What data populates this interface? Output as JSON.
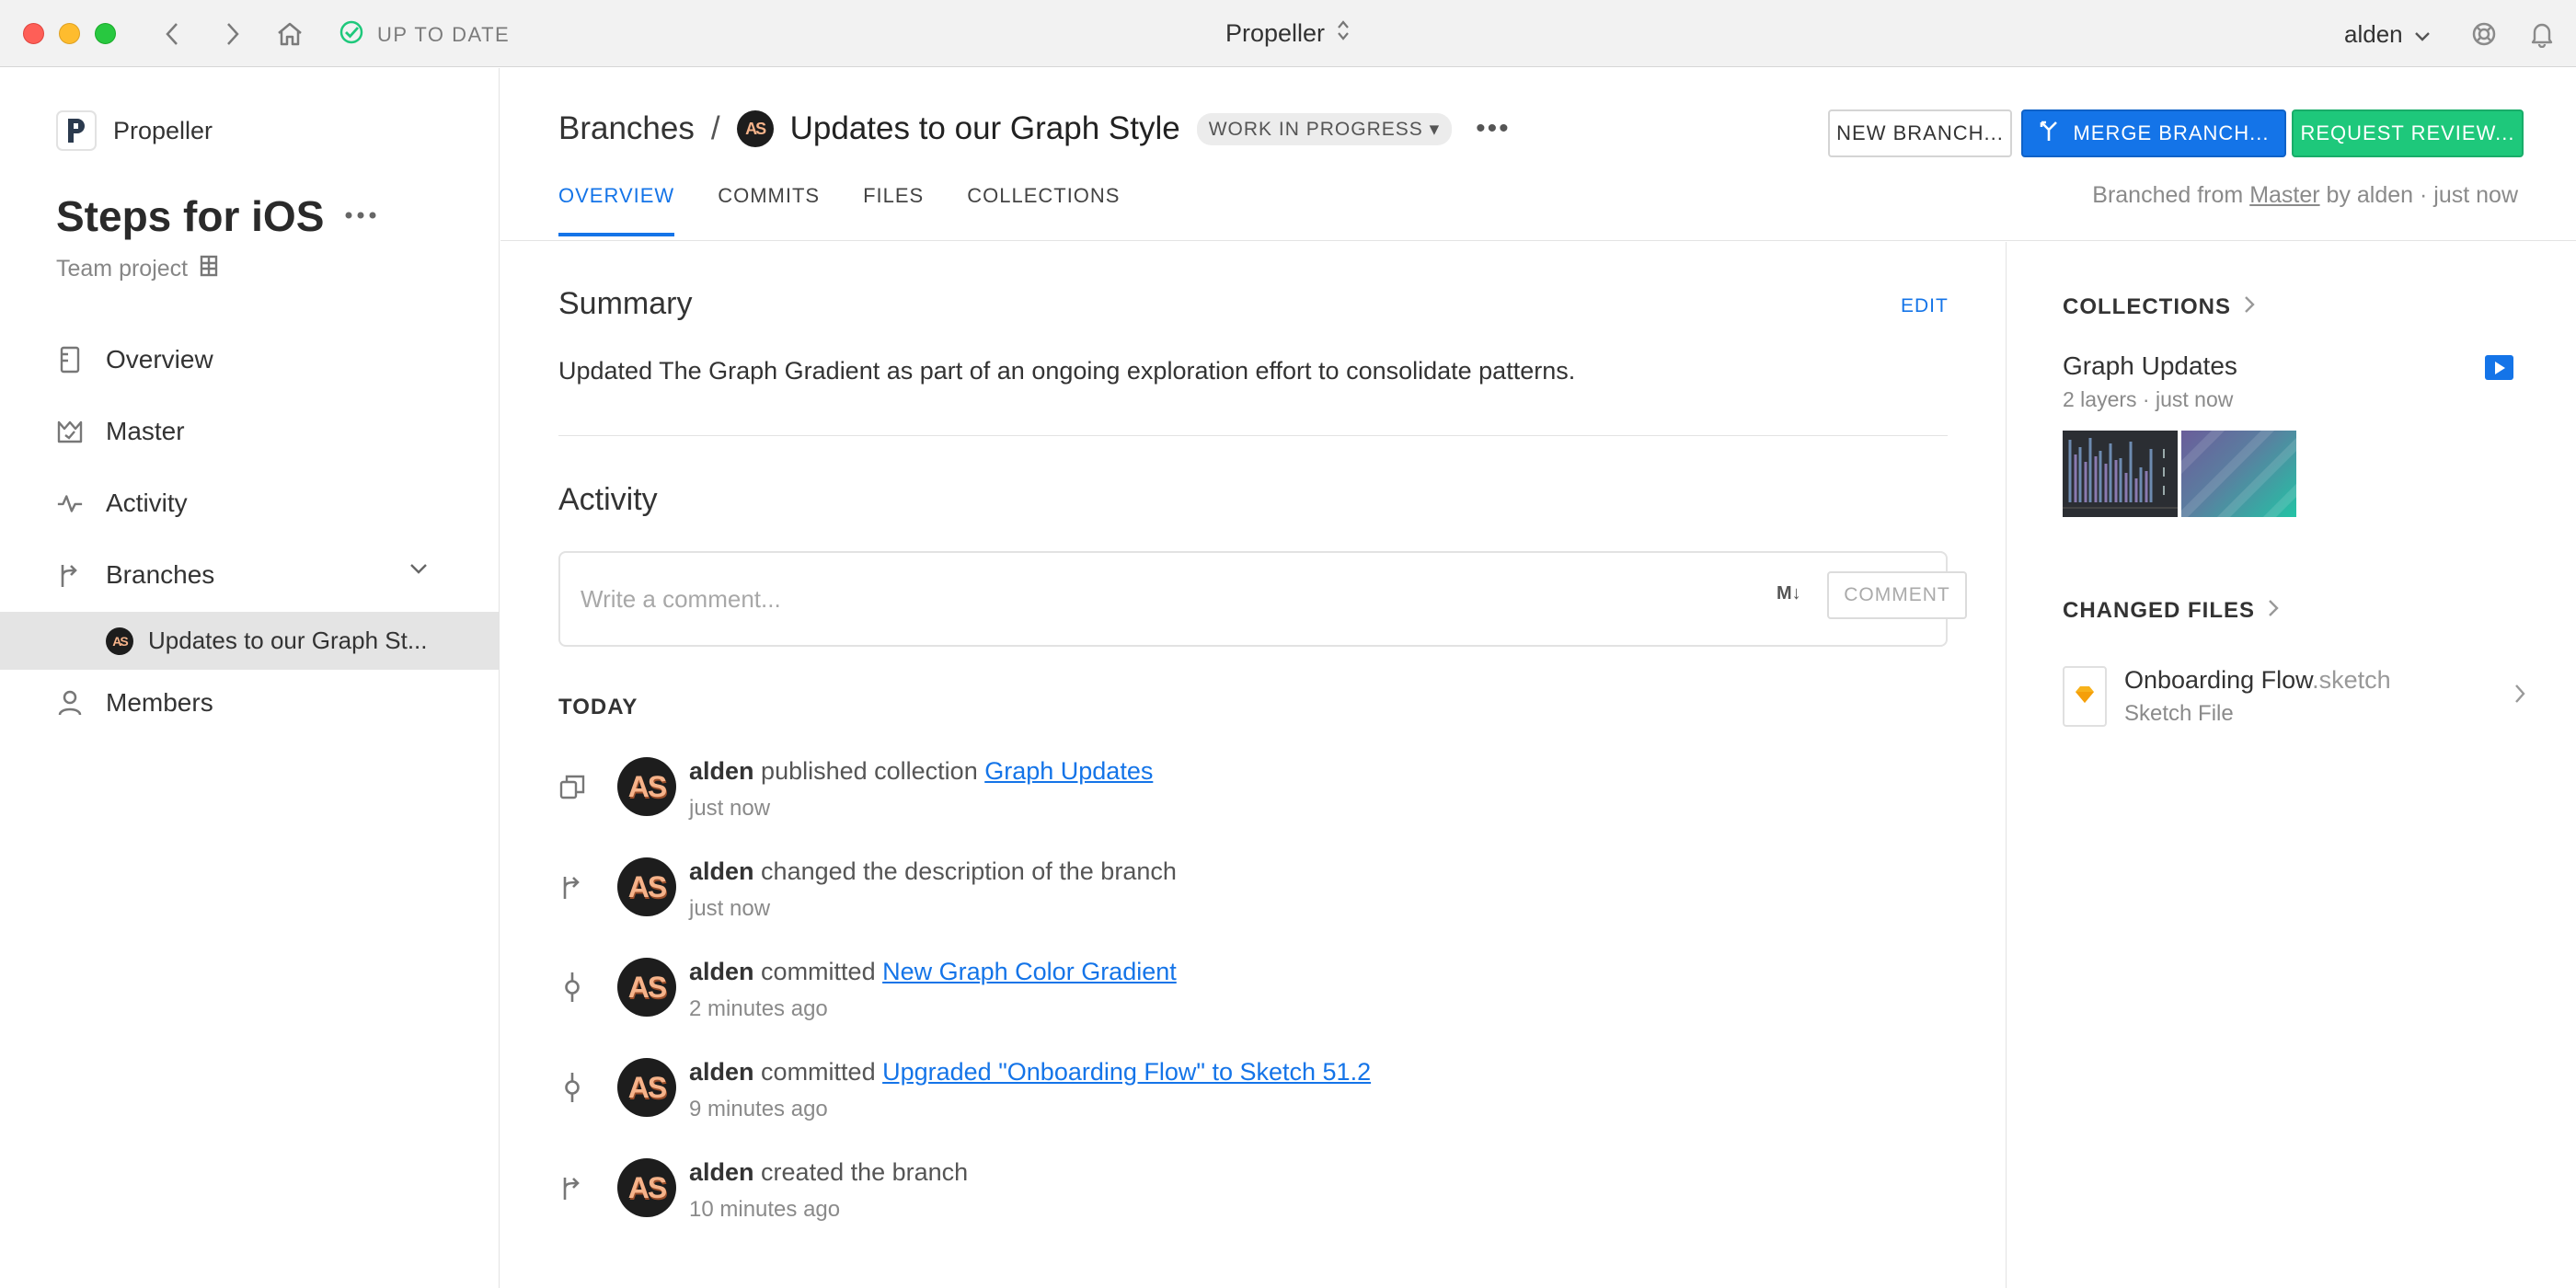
{
  "titlebar": {
    "sync_status": "UP TO DATE",
    "app_name": "Propeller",
    "user": "alden"
  },
  "sidebar": {
    "team_name": "Propeller",
    "project_title": "Steps for iOS",
    "project_type": "Team project",
    "nav": [
      {
        "label": "Overview"
      },
      {
        "label": "Master"
      },
      {
        "label": "Activity"
      },
      {
        "label": "Branches"
      },
      {
        "label": "Members"
      }
    ],
    "current_branch": "Updates to our Graph St..."
  },
  "header": {
    "crumb_root": "Branches",
    "crumb_sep": "/",
    "branch_title": "Updates to our Graph Style",
    "status": "WORK IN PROGRESS ▾",
    "more": "•••",
    "buttons": {
      "new_branch": "NEW BRANCH...",
      "merge_branch": "MERGE BRANCH...",
      "request_review": "REQUEST REVIEW..."
    },
    "tabs": [
      {
        "label": "OVERVIEW"
      },
      {
        "label": "COMMITS"
      },
      {
        "label": "FILES"
      },
      {
        "label": "COLLECTIONS"
      }
    ],
    "branched_prefix": "Branched from",
    "branched_source": "Master",
    "branched_suffix": "by alden · just now"
  },
  "summary": {
    "heading": "Summary",
    "edit": "EDIT",
    "text": "Updated The Graph Gradient as part of an ongoing exploration effort to consolidate patterns."
  },
  "activity": {
    "heading": "Activity",
    "comment_placeholder": "Write a comment...",
    "markdown_icon": "M↓",
    "comment_button": "COMMENT",
    "day_label": "TODAY",
    "items": [
      {
        "icon": "collection-icon",
        "user": "alden",
        "action": "published collection",
        "link": "Graph Updates",
        "time": "just now"
      },
      {
        "icon": "branch-icon",
        "user": "alden",
        "action": "changed the description of the branch",
        "link": "",
        "time": "just now"
      },
      {
        "icon": "commit-icon",
        "user": "alden",
        "action": "committed",
        "link": "New Graph Color Gradient",
        "time": "2 minutes ago"
      },
      {
        "icon": "commit-icon",
        "user": "alden",
        "action": "committed",
        "link": "Upgraded \"Onboarding Flow\" to Sketch 51.2",
        "time": "9 minutes ago"
      },
      {
        "icon": "branch-icon",
        "user": "alden",
        "action": "created the branch",
        "link": "",
        "time": "10 minutes ago"
      }
    ]
  },
  "right_panel": {
    "collections_heading": "COLLECTIONS",
    "collection": {
      "title": "Graph Updates",
      "meta": "2 layers · just now"
    },
    "changed_files_heading": "CHANGED FILES",
    "file": {
      "name": "Onboarding Flow",
      "ext": ".sketch",
      "type": "Sketch File"
    }
  },
  "avatar_initials": "AS",
  "colors": {
    "accent": "#1474e8",
    "success": "#1ec87b",
    "sketch": "#f7b21b"
  }
}
